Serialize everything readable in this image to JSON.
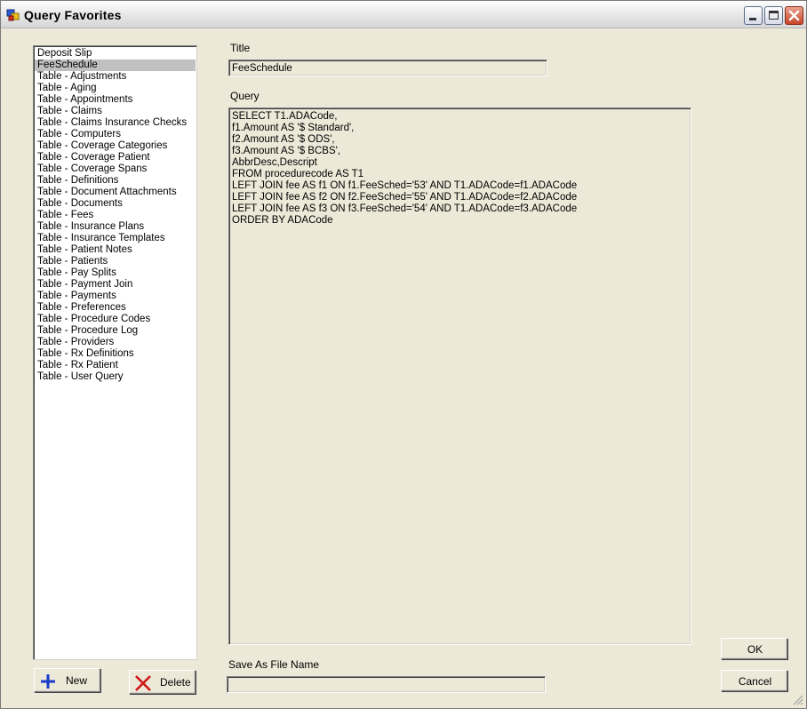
{
  "window": {
    "title": "Query Favorites"
  },
  "favorites_list": {
    "selected_index": 1,
    "items": [
      "Deposit Slip",
      "FeeSchedule",
      "Table - Adjustments",
      "Table - Aging",
      "Table - Appointments",
      "Table - Claims",
      "Table - Claims Insurance Checks",
      "Table - Computers",
      "Table - Coverage Categories",
      "Table - Coverage Patient",
      "Table - Coverage Spans",
      "Table - Definitions",
      "Table - Document Attachments",
      "Table - Documents",
      "Table - Fees",
      "Table - Insurance Plans",
      "Table - Insurance Templates",
      "Table - Patient Notes",
      "Table - Patients",
      "Table - Pay Splits",
      "Table - Payment Join",
      "Table - Payments",
      "Table - Preferences",
      "Table - Procedure Codes",
      "Table - Procedure Log",
      "Table - Providers",
      "Table - Rx Definitions",
      "Table - Rx Patient",
      "Table - User Query"
    ]
  },
  "title_field": {
    "label": "Title",
    "value": "FeeSchedule"
  },
  "query_field": {
    "label": "Query",
    "value": "SELECT T1.ADACode,\nf1.Amount AS '$ Standard',\nf2.Amount AS '$ ODS',\nf3.Amount AS '$ BCBS',\nAbbrDesc,Descript\nFROM procedurecode AS T1\nLEFT JOIN fee AS f1 ON f1.FeeSched='53' AND T1.ADACode=f1.ADACode\nLEFT JOIN fee AS f2 ON f2.FeeSched='55' AND T1.ADACode=f2.ADACode\nLEFT JOIN fee AS f3 ON f3.FeeSched='54' AND T1.ADACode=f3.ADACode\nORDER BY ADACode"
  },
  "filename_field": {
    "label": "Save As File Name",
    "value": ""
  },
  "buttons": {
    "new": "New",
    "delete": "Delete",
    "ok": "OK",
    "cancel": "Cancel"
  },
  "colors": {
    "new_icon": "#1a3cc8",
    "delete_icon": "#d01818"
  }
}
